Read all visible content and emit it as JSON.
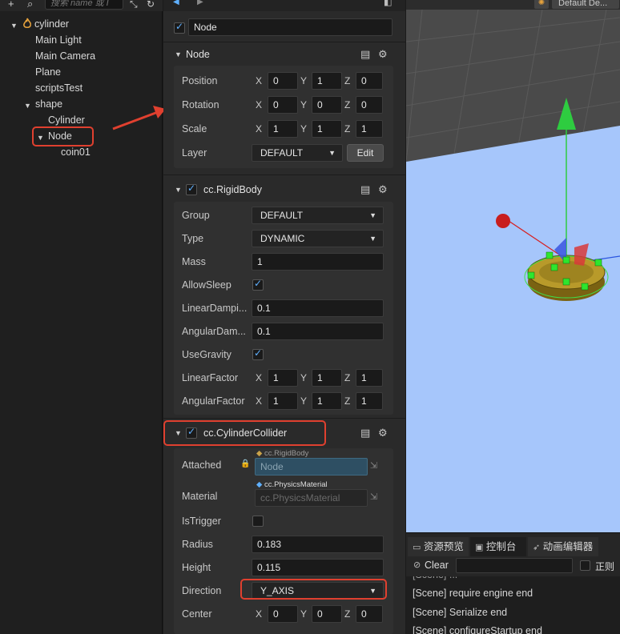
{
  "hierarchy": {
    "search_placeholder": "搜索 name 或 I",
    "root": "cylinder",
    "items": [
      "Main Light",
      "Main Camera",
      "Plane",
      "scriptsTest",
      "shape",
      "Cylinder",
      "Node",
      "coin01"
    ]
  },
  "inspector": {
    "node_name": "Node",
    "node_section": {
      "title": "Node",
      "position": {
        "label": "Position",
        "x": "0",
        "y": "1",
        "z": "0"
      },
      "rotation": {
        "label": "Rotation",
        "x": "0",
        "y": "0",
        "z": "0"
      },
      "scale": {
        "label": "Scale",
        "x": "1",
        "y": "1",
        "z": "1"
      },
      "layer": {
        "label": "Layer",
        "value": "DEFAULT",
        "edit_label": "Edit"
      }
    },
    "rigidbody": {
      "title": "cc.RigidBody",
      "group": {
        "label": "Group",
        "value": "DEFAULT"
      },
      "type": {
        "label": "Type",
        "value": "DYNAMIC"
      },
      "mass": {
        "label": "Mass",
        "value": "1"
      },
      "allow_sleep": {
        "label": "AllowSleep"
      },
      "linear_damping": {
        "label": "LinearDampi...",
        "value": "0.1"
      },
      "angular_damping": {
        "label": "AngularDam...",
        "value": "0.1"
      },
      "use_gravity": {
        "label": "UseGravity"
      },
      "linear_factor": {
        "label": "LinearFactor",
        "x": "1",
        "y": "1",
        "z": "1"
      },
      "angular_factor": {
        "label": "AngularFactor",
        "x": "1",
        "y": "1",
        "z": "1"
      }
    },
    "collider": {
      "title": "cc.CylinderCollider",
      "attached": {
        "label": "Attached",
        "tag": "cc.RigidBody",
        "value": "Node"
      },
      "material": {
        "label": "Material",
        "tag": "cc.PhysicsMaterial",
        "value": "cc.PhysicsMaterial"
      },
      "is_trigger": {
        "label": "IsTrigger"
      },
      "radius": {
        "label": "Radius",
        "value": "0.183"
      },
      "height": {
        "label": "Height",
        "value": "0.115"
      },
      "direction": {
        "label": "Direction",
        "value": "Y_AXIS"
      },
      "center": {
        "label": "Center",
        "x": "0",
        "y": "0",
        "z": "0"
      }
    },
    "axis_labels": {
      "x": "X",
      "y": "Y",
      "z": "Z"
    }
  },
  "scene": {
    "toolbar_label": "Default De..."
  },
  "console": {
    "tabs": [
      "资源预览",
      "控制台",
      "动画编辑器"
    ],
    "clear_label": "Clear",
    "regex_label": "正则",
    "logs": [
      "[Scene] require engine end",
      "[Scene] Serialize end",
      "[Scene] configureStartup end"
    ]
  },
  "colors": {
    "highlight": "#e0402f",
    "plane": "#a6c6fb",
    "gizmo_green": "#2ecc40",
    "accent": "#5fb0ff"
  }
}
